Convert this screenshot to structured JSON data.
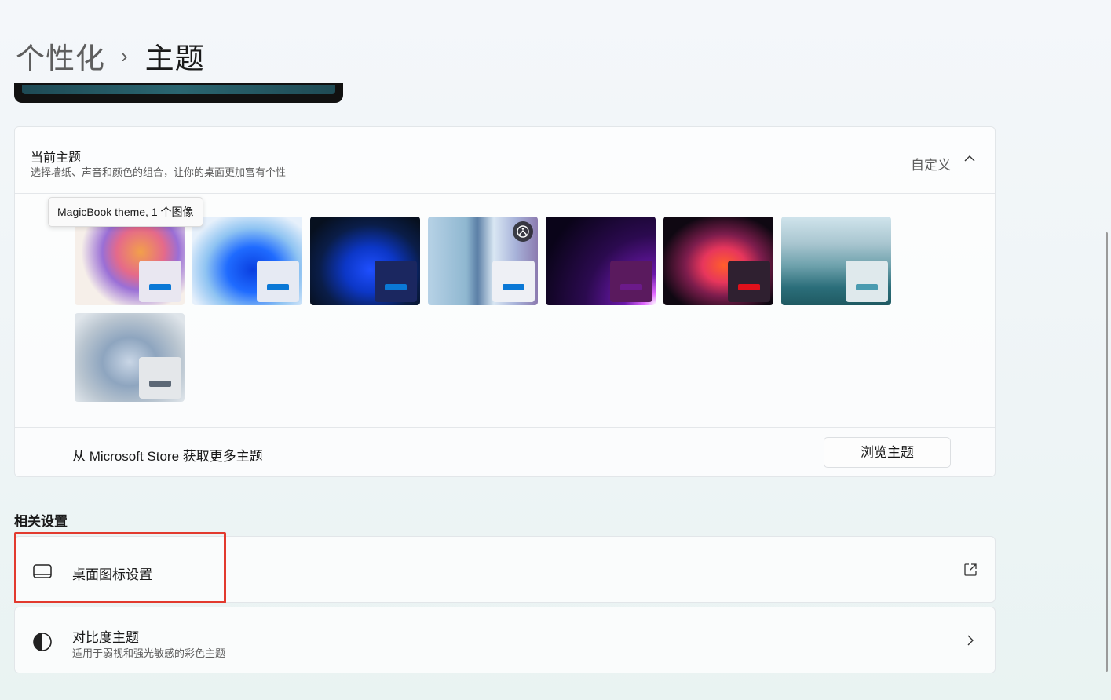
{
  "breadcrumb": {
    "parent": "个性化",
    "separator": "›",
    "current": "主题"
  },
  "current_theme": {
    "title": "当前主题",
    "subtitle": "选择墙纸、声音和颜色的组合，让你的桌面更加富有个性",
    "value": "自定义",
    "expand_icon": "chevron-up-icon"
  },
  "tooltip": "MagicBook theme, 1 个图像",
  "themes": [
    {
      "name": "magicbook",
      "mini_bg": "#e9e7f1",
      "accent": "#0a78d6"
    },
    {
      "name": "windows-light",
      "mini_bg": "#e6eaf3",
      "accent": "#0a78d6"
    },
    {
      "name": "windows-dark",
      "mini_bg": "#1b2760",
      "accent": "#0a78d6"
    },
    {
      "name": "spotlight",
      "mini_bg": "#eef0f5",
      "accent": "#0a78d6",
      "badge_icon": "spotlight-icon"
    },
    {
      "name": "glow",
      "mini_bg": "#5a1a5e",
      "accent": "#6b1a8a"
    },
    {
      "name": "captured-motion",
      "mini_bg": "#2f2030",
      "accent": "#e0101b"
    },
    {
      "name": "sunrise",
      "mini_bg": "#dfe9ec",
      "accent": "#4a9bb0"
    },
    {
      "name": "flow",
      "mini_bg": "#e4e7ea",
      "accent": "#5c6876"
    }
  ],
  "store": {
    "text": "从 Microsoft Store 获取更多主题",
    "button": "浏览主题"
  },
  "related": {
    "heading": "相关设置",
    "desktop_icons": {
      "label": "桌面图标设置",
      "icon": "monitor-icon",
      "trail_icon": "open-external-icon"
    },
    "contrast": {
      "label": "对比度主题",
      "subtitle": "适用于弱视和强光敏感的彩色主题",
      "icon": "contrast-icon",
      "trail_icon": "chevron-right-icon"
    }
  },
  "highlight_color": "#e23a2e"
}
